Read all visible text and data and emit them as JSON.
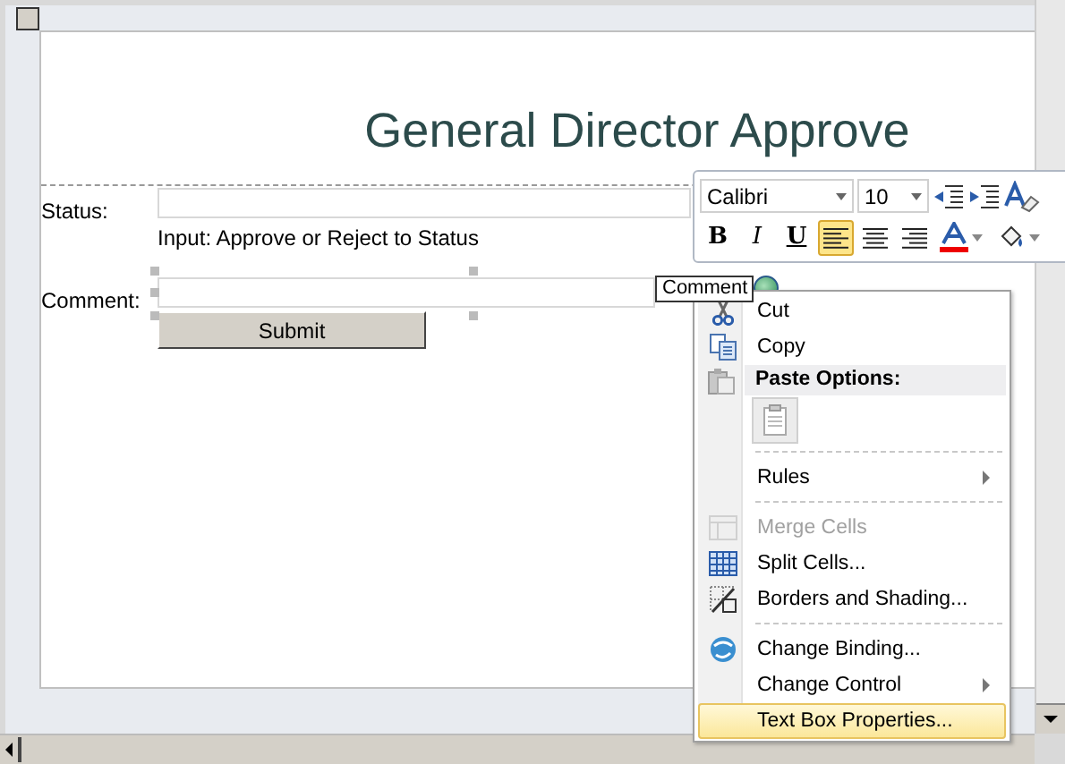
{
  "form": {
    "title": "General Director Approve",
    "fields": [
      {
        "label": "Status:",
        "hint": "Input: Approve or Reject to Status",
        "selected": false
      },
      {
        "label": "Comment:",
        "selected": true
      }
    ],
    "tooltip": "Comment",
    "submit": "Submit"
  },
  "mini_toolbar": {
    "font": "Calibri",
    "size": "10",
    "buttons": [
      {
        "kind": "bold",
        "label": "B"
      },
      {
        "kind": "italic",
        "label": "I"
      },
      {
        "kind": "underline",
        "label": "U"
      },
      {
        "kind": "align-left",
        "selected": true
      },
      {
        "kind": "align-center",
        "selected": false
      },
      {
        "kind": "align-right",
        "selected": false
      },
      {
        "kind": "font-color"
      },
      {
        "kind": "fill-color"
      }
    ]
  },
  "context_menu": {
    "items": [
      {
        "kind": "item",
        "label": "Cut",
        "disabled": false,
        "selected": false,
        "submenu": false
      },
      {
        "kind": "item",
        "label": "Copy",
        "disabled": false,
        "selected": false,
        "submenu": false
      },
      {
        "kind": "header",
        "label": "Paste Options:"
      },
      {
        "kind": "paste"
      },
      {
        "kind": "separator"
      },
      {
        "kind": "item",
        "label": "Rules",
        "disabled": false,
        "selected": false,
        "submenu": true
      },
      {
        "kind": "separator"
      },
      {
        "kind": "item",
        "label": "Merge Cells",
        "disabled": true,
        "selected": false,
        "submenu": false
      },
      {
        "kind": "item",
        "label": "Split Cells...",
        "disabled": false,
        "selected": false,
        "submenu": false
      },
      {
        "kind": "item",
        "label": "Borders and Shading...",
        "disabled": false,
        "selected": false,
        "submenu": false
      },
      {
        "kind": "separator"
      },
      {
        "kind": "item",
        "label": "Change Binding...",
        "disabled": false,
        "selected": false,
        "submenu": false
      },
      {
        "kind": "item",
        "label": "Change Control",
        "disabled": false,
        "selected": false,
        "submenu": true
      },
      {
        "kind": "item",
        "label": "Text Box Properties...",
        "disabled": false,
        "selected": true,
        "submenu": false
      }
    ]
  }
}
